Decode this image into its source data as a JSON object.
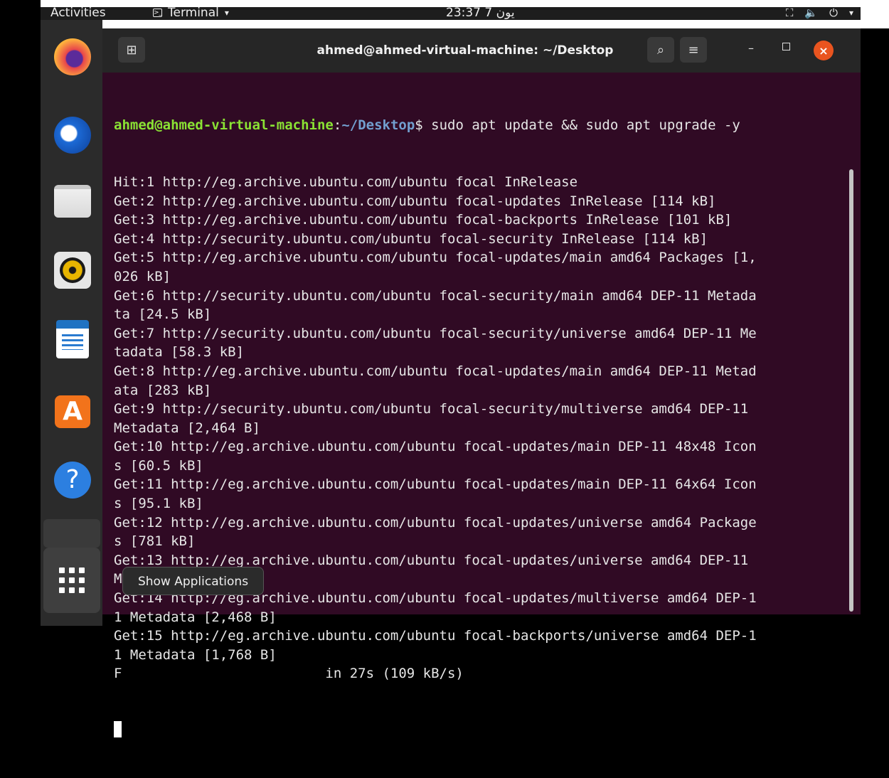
{
  "topbar": {
    "activities": "Activities",
    "app_menu": "Terminal",
    "app_menu_caret": "▾",
    "clock": "يون 7  23:37",
    "tray": {
      "network_icon": "network-icon",
      "volume_icon": "volume-icon",
      "power_icon": "power-icon",
      "caret": "▾"
    }
  },
  "dock": {
    "items": [
      {
        "name": "Firefox",
        "icon": "firefox-icon"
      },
      {
        "name": "Thunderbird",
        "icon": "thunderbird-icon"
      },
      {
        "name": "Files",
        "icon": "files-icon"
      },
      {
        "name": "Rhythmbox",
        "icon": "rhythmbox-icon"
      },
      {
        "name": "LibreOffice Writer",
        "icon": "writer-icon"
      },
      {
        "name": "Ubuntu Software",
        "icon": "software-icon"
      },
      {
        "name": "Help",
        "icon": "help-icon"
      }
    ],
    "help_glyph": "?",
    "software_glyph": "A",
    "show_apps_tooltip": "Show Applications"
  },
  "terminal": {
    "title": "ahmed@ahmed-virtual-machine: ~/Desktop",
    "prompt_user": "ahmed@ahmed-virtual-machine",
    "prompt_sep": ":",
    "prompt_path": "~/Desktop",
    "prompt_end": "$ ",
    "command": "sudo apt update && sudo apt upgrade -y",
    "output_lines": [
      "Hit:1 http://eg.archive.ubuntu.com/ubuntu focal InRelease",
      "Get:2 http://eg.archive.ubuntu.com/ubuntu focal-updates InRelease [114 kB]",
      "Get:3 http://eg.archive.ubuntu.com/ubuntu focal-backports InRelease [101 kB]",
      "Get:4 http://security.ubuntu.com/ubuntu focal-security InRelease [114 kB]",
      "Get:5 http://eg.archive.ubuntu.com/ubuntu focal-updates/main amd64 Packages [1,",
      "026 kB]",
      "Get:6 http://security.ubuntu.com/ubuntu focal-security/main amd64 DEP-11 Metada",
      "ta [24.5 kB]",
      "Get:7 http://security.ubuntu.com/ubuntu focal-security/universe amd64 DEP-11 Me",
      "tadata [58.3 kB]",
      "Get:8 http://eg.archive.ubuntu.com/ubuntu focal-updates/main amd64 DEP-11 Metad",
      "ata [283 kB]",
      "Get:9 http://security.ubuntu.com/ubuntu focal-security/multiverse amd64 DEP-11",
      "Metadata [2,464 B]",
      "Get:10 http://eg.archive.ubuntu.com/ubuntu focal-updates/main DEP-11 48x48 Icon",
      "s [60.5 kB]",
      "Get:11 http://eg.archive.ubuntu.com/ubuntu focal-updates/main DEP-11 64x64 Icon",
      "s [95.1 kB]",
      "Get:12 http://eg.archive.ubuntu.com/ubuntu focal-updates/universe amd64 Package",
      "s [781 kB]",
      "Get:13 http://eg.archive.ubuntu.com/ubuntu focal-updates/universe amd64 DEP-11",
      "Metadata [330 kB]",
      "Get:14 http://eg.archive.ubuntu.com/ubuntu focal-updates/multiverse amd64 DEP-1",
      "1 Metadata [2,468 B]",
      "Get:15 http://eg.archive.ubuntu.com/ubuntu focal-backports/universe amd64 DEP-1",
      "1 Metadata [1,768 B]",
      "F                         in 27s (109 kB/s)"
    ],
    "buttons": {
      "new_tab": "⊞",
      "search": "⌕",
      "menu": "≡",
      "minimize": "–",
      "close": "×"
    }
  },
  "colors": {
    "terminal_bg": "#300a24",
    "prompt_user": "#8ae234",
    "prompt_path": "#729fcf",
    "close_button": "#e9541f"
  }
}
